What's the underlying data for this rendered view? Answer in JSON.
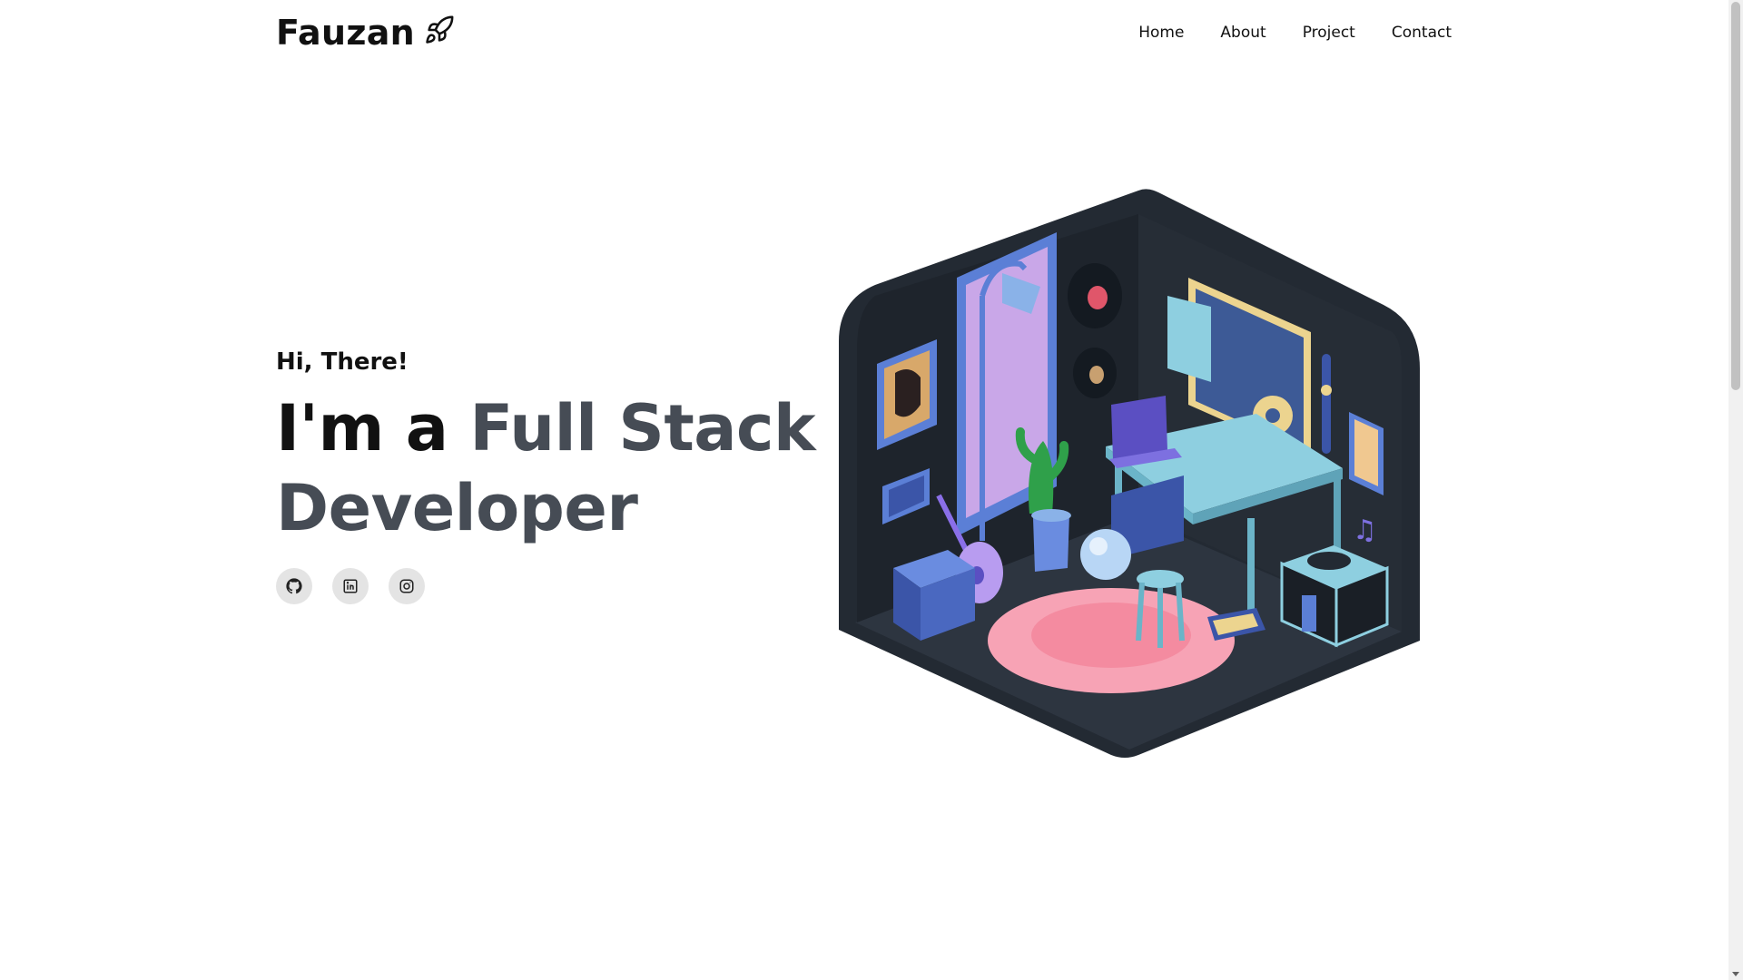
{
  "brand": {
    "name": "Fauzan",
    "icon": "rocket-icon"
  },
  "nav": {
    "items": [
      {
        "label": "Home"
      },
      {
        "label": "About"
      },
      {
        "label": "Project"
      },
      {
        "label": "Contact"
      }
    ]
  },
  "hero": {
    "greeting": "Hi, There!",
    "headline_lead": "I'm a",
    "headline_role": "Full Stack Developer"
  },
  "socials": [
    {
      "icon": "github-icon"
    },
    {
      "icon": "linkedin-icon"
    },
    {
      "icon": "instagram-icon"
    }
  ],
  "colors": {
    "text": "#111111",
    "role_text": "#464c55",
    "social_bg": "#e4e4e4",
    "room_dark": "#232a33",
    "room_purple": "#c9a7e8",
    "room_blue": "#5b7fd6",
    "rug_pink": "#f7a3b5",
    "desk_teal": "#8ecfe0"
  }
}
